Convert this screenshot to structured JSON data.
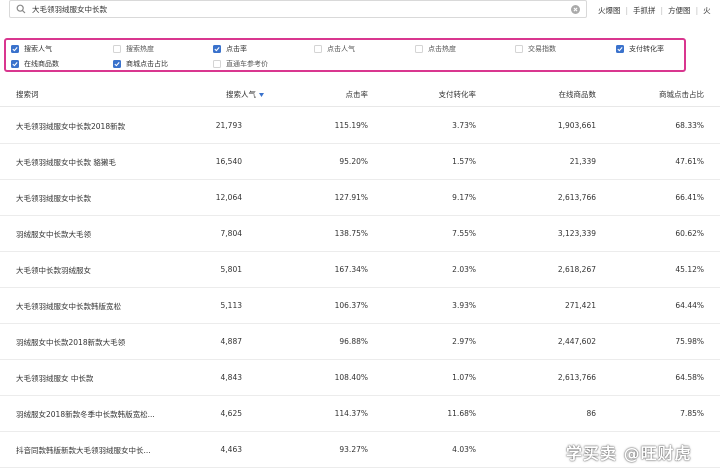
{
  "search": {
    "query": "大毛领羽绒服女中长款",
    "links": [
      "火爆图",
      "手抓拼",
      "方便图",
      "火"
    ]
  },
  "colors": {
    "accent": "#3a72cc",
    "highlight_border": "#d9368f"
  },
  "filters": [
    {
      "label": "搜索人气",
      "checked": true
    },
    {
      "label": "搜索热度",
      "checked": false
    },
    {
      "label": "点击率",
      "checked": true
    },
    {
      "label": "点击人气",
      "checked": false
    },
    {
      "label": "点击热度",
      "checked": false
    },
    {
      "label": "交易指数",
      "checked": false
    },
    {
      "label": "支付转化率",
      "checked": true
    },
    {
      "label": "在线商品数",
      "checked": true
    },
    {
      "label": "商城点击占比",
      "checked": true
    },
    {
      "label": "直通车参考价",
      "checked": false
    }
  ],
  "table": {
    "columns": [
      "搜索词",
      "搜索人气",
      "点击率",
      "支付转化率",
      "在线商品数",
      "商城点击占比"
    ],
    "sorted_column": "搜索人气",
    "rows": [
      [
        "大毛领羽绒服女中长款2018新款",
        "21,793",
        "115.19%",
        "3.73%",
        "1,903,661",
        "68.33%"
      ],
      [
        "大毛领羽绒服女中长款 貉獭毛",
        "16,540",
        "95.20%",
        "1.57%",
        "21,339",
        "47.61%"
      ],
      [
        "大毛领羽绒服女中长款",
        "12,064",
        "127.91%",
        "9.17%",
        "2,613,766",
        "66.41%"
      ],
      [
        "羽绒服女中长款大毛领",
        "7,804",
        "138.75%",
        "7.55%",
        "3,123,339",
        "60.62%"
      ],
      [
        "大毛领中长款羽绒服女",
        "5,801",
        "167.34%",
        "2.03%",
        "2,618,267",
        "45.12%"
      ],
      [
        "大毛领羽绒服女中长款韩版宽松",
        "5,113",
        "106.37%",
        "3.93%",
        "271,421",
        "64.44%"
      ],
      [
        "羽绒服女中长款2018新款大毛领",
        "4,887",
        "96.88%",
        "2.97%",
        "2,447,602",
        "75.98%"
      ],
      [
        "大毛领羽绒服女 中长款",
        "4,843",
        "108.40%",
        "1.07%",
        "2,613,766",
        "64.58%"
      ],
      [
        "羽绒服女2018新款冬季中长款韩版宽松...",
        "4,625",
        "114.37%",
        "11.68%",
        "86",
        "7.85%"
      ],
      [
        "抖音同款韩版新款大毛领羽绒服女中长...",
        "4,463",
        "93.27%",
        "4.03%",
        "",
        ""
      ]
    ]
  },
  "watermark": "学买卖 @旺财虎"
}
